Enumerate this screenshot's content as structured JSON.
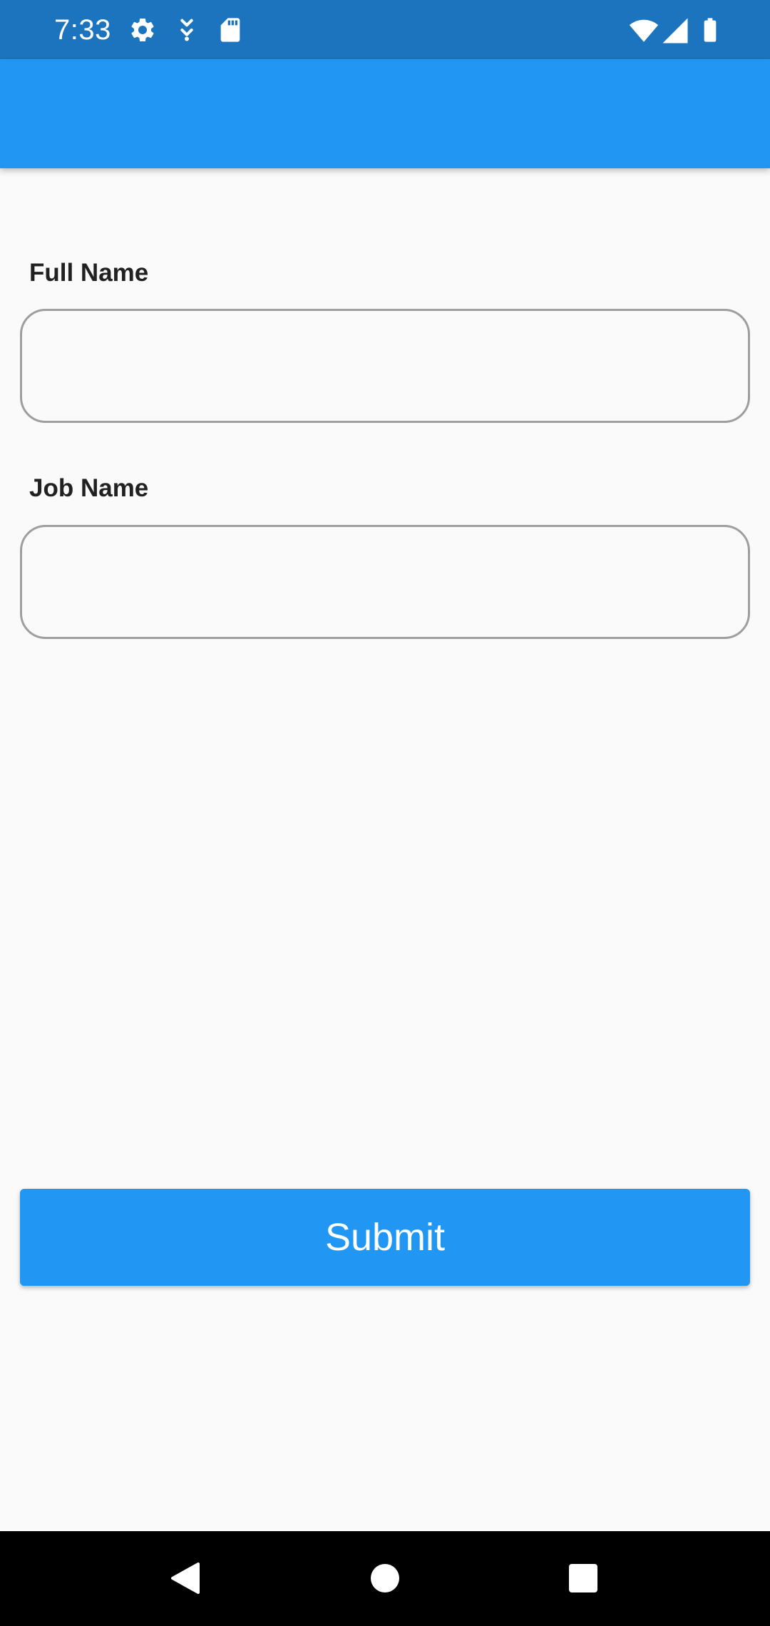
{
  "status_bar": {
    "time": "7:33",
    "left_icons": [
      "gear-icon",
      "download-arrow-icon",
      "sd-card-icon"
    ],
    "right_icons": [
      "wifi-icon",
      "cellular-signal-icon",
      "battery-icon"
    ],
    "background": "#1b74bd"
  },
  "app_bar": {
    "title": "",
    "background": "#2196f3"
  },
  "form": {
    "full_name": {
      "label": "Full Name",
      "value": "",
      "placeholder": ""
    },
    "job_name": {
      "label": "Job Name",
      "value": "",
      "placeholder": ""
    },
    "submit_label": "Submit"
  },
  "nav_bar": {
    "buttons": [
      "back-icon",
      "home-icon",
      "recents-icon"
    ]
  },
  "colors": {
    "accent": "#2196f3",
    "background": "#fafafa",
    "field_border": "#9e9e9e",
    "label_text": "#212121"
  }
}
